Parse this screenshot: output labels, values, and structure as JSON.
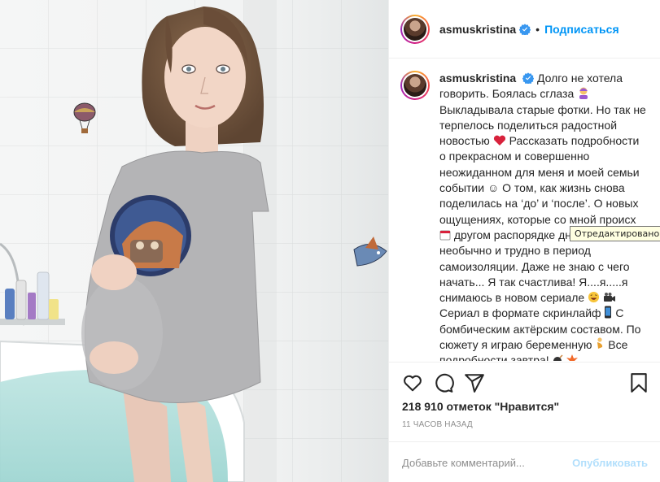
{
  "post": {
    "username": "asmuskristina",
    "follow_label": "Подписаться",
    "separator": "•",
    "verified_icon": "verified-badge-icon",
    "caption_lines": [
      "Долго не хотела говорить. Боялась сглаза",
      "Выкладывала старые фотки. Но так не терпелось поделиться радостной новостью",
      "Рассказать подробности о прекрасном и совершенно неожиданном для меня и моей семьи событии ☺ О том, как жизнь снова поделилась на ‘до’ и ‘после’. О новых ощущениях, которые со мной происх",
      "другом распорядке дня",
      "И как это необычно и трудно в период самоизоляции. Даже не знаю с чего начать... Я так счастлива! Я....я.....я снимаюсь в новом сериале",
      "Сериал в формате скринлайф",
      "С бомбическим актёрским составом. По сюжету я играю беременную",
      "Все подробности завтра!"
    ],
    "tooltip": "Отредактировано",
    "likes": "218 910 отметок \"Нравится\"",
    "time_ago": "11 ЧАСОВ НАЗАД",
    "comment_placeholder": "Добавьте комментарий...",
    "publish_label": "Опубликовать"
  },
  "colors": {
    "accent": "#0095f6",
    "publish_disabled": "#b2dffc",
    "muted": "#8e8e8e",
    "text": "#262626"
  },
  "icons": [
    "heart-icon",
    "comment-icon",
    "share-icon",
    "bookmark-icon"
  ]
}
